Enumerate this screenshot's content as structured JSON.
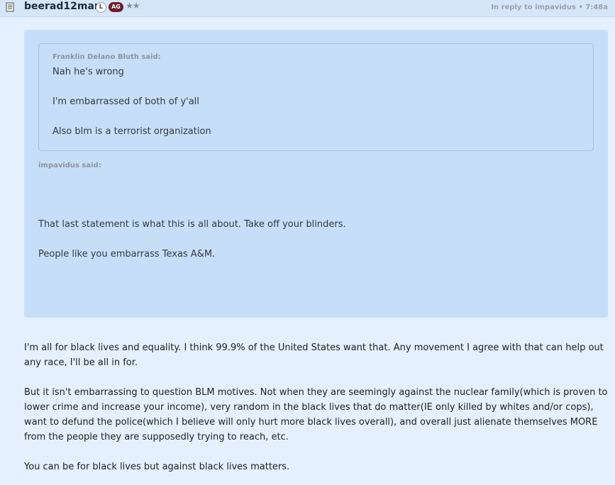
{
  "header": {
    "username": "beerad12man",
    "badge_l": "L",
    "badge_ag": "AG",
    "stars": "★★",
    "reply_prefix": "In reply to ",
    "reply_user": "impavidus",
    "reply_time": " • 7:48a"
  },
  "inner_quote": {
    "author": "Franklin Delano Bluth said:",
    "lines": [
      "Nah he's wrong",
      "I'm embarrassed of both of y'all",
      "Also blm is a terrorist organization"
    ]
  },
  "outer_quote": {
    "author": "impavidus said:",
    "lines": [
      "That last statement is what this is all about. Take off your blinders.",
      "People like you embarrass Texas A&M."
    ]
  },
  "post_body": {
    "paragraphs": [
      "I'm all for black lives and equality. I think 99.9% of the United States want that. Any movement I agree with that can help out any race, I'll be all in for.",
      "But it isn't embarrassing to question BLM motives. Not when they are seemingly against the nuclear family(which is proven to lower crime and increase your income), very random in the black lives that do matter(IE only killed by whites and/or cops), want to defund the police(which I believe will only hurt more black lives overall), and overall just alienate themselves MORE from the people they are supposedly trying to reach, etc.",
      "You can be for black lives but against black lives matters."
    ]
  },
  "icons": {
    "post_icon": "document-icon"
  }
}
